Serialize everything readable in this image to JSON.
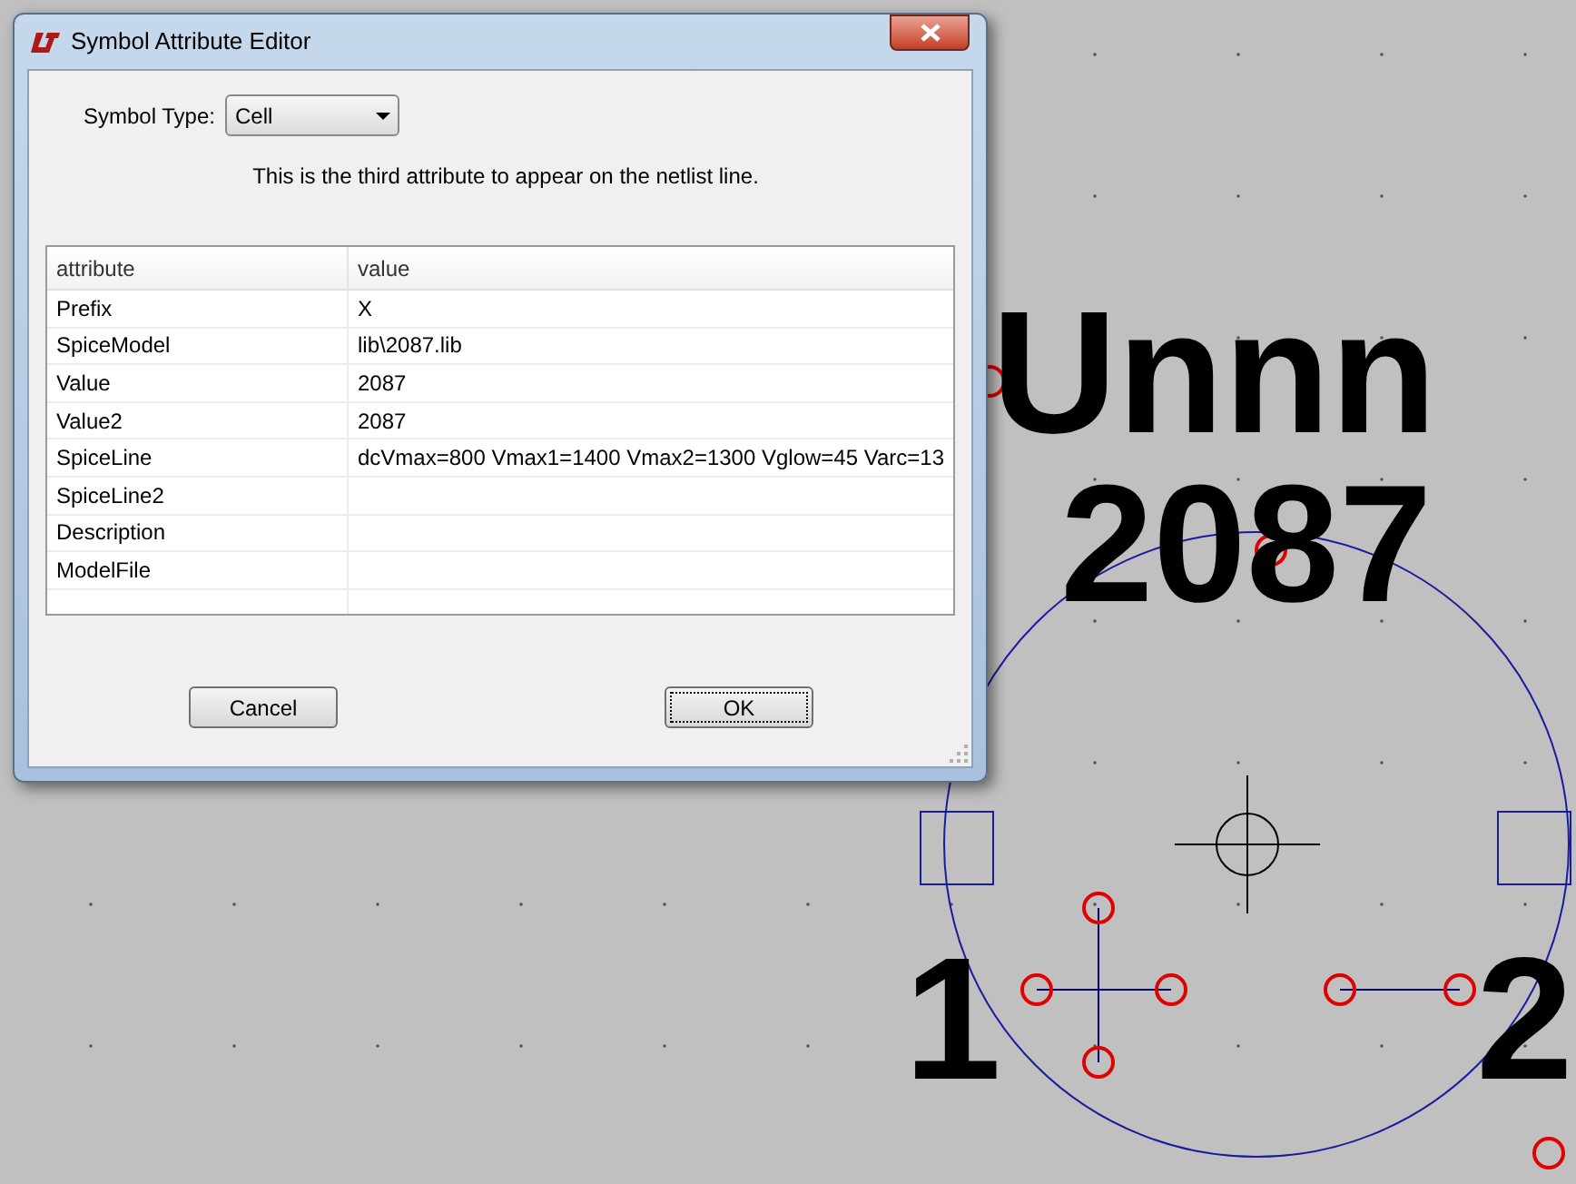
{
  "window": {
    "title": "Symbol Attribute Editor"
  },
  "symbol_type": {
    "label": "Symbol Type:",
    "value": "Cell"
  },
  "hint": "This is the third attribute to appear on the netlist line.",
  "table": {
    "columns": [
      "attribute",
      "value"
    ],
    "rows": [
      {
        "attribute": "Prefix",
        "value": "X"
      },
      {
        "attribute": "SpiceModel",
        "value": "lib\\2087.lib"
      },
      {
        "attribute": "Value",
        "value": "2087"
      },
      {
        "attribute": "Value2",
        "value": "2087"
      },
      {
        "attribute": "SpiceLine",
        "value": "dcVmax=800 Vmax1=1400 Vmax2=1300 Vglow=45 Varc=13"
      },
      {
        "attribute": "SpiceLine2"
      },
      {
        "attribute": "Description"
      },
      {
        "attribute": "ModelFile"
      }
    ]
  },
  "buttons": [
    {
      "label": "Cancel",
      "focused": false
    },
    {
      "label": "OK",
      "focused": true
    }
  ],
  "canvas": {
    "labels": [
      {
        "text": "Unnn",
        "kind": "designator"
      },
      {
        "text": "2087",
        "kind": "value"
      },
      {
        "text": "1",
        "kind": "pin_left"
      },
      {
        "text": "2",
        "kind": "pin_right"
      }
    ]
  }
}
